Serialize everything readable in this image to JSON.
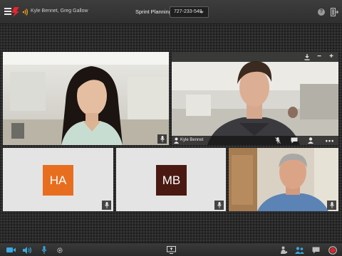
{
  "header": {
    "participants": "Kyle Bennet, Greg Gallow",
    "meeting_title": "Sprint Planning",
    "meeting_id": "727-233-549",
    "help_glyph": "?"
  },
  "tiles": [
    {
      "id": "video-woman",
      "kind": "video"
    },
    {
      "id": "video-kyle",
      "kind": "video",
      "name": "Kyle Bennet"
    },
    {
      "id": "avatar-ha",
      "kind": "initials",
      "initials": "HA",
      "color": "#e86e1f"
    },
    {
      "id": "avatar-mb",
      "kind": "initials",
      "initials": "MB",
      "color": "#4a1a12"
    },
    {
      "id": "video-older-man",
      "kind": "video"
    }
  ],
  "tile_controls": {
    "minus": "−",
    "plus": "+",
    "more": "•••"
  },
  "colors": {
    "accent": "#3aa9e0",
    "record": "#e0202a",
    "logo": "#e8242e",
    "audio": "#f0a020"
  },
  "icons": {
    "topbar": [
      "menu-icon",
      "logo-icon",
      "audio-icon",
      "help-icon",
      "leave-icon"
    ],
    "bottombar": [
      "camera-icon",
      "speaker-icon",
      "microphone-icon",
      "settings-icon",
      "screen-share-icon",
      "raise-hand-icon",
      "participants-icon",
      "chat-icon",
      "record-icon"
    ]
  }
}
